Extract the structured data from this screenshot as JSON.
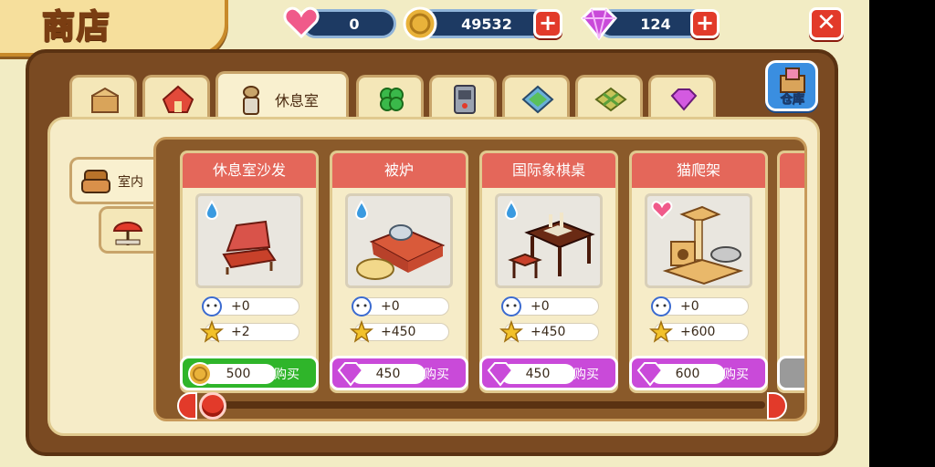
{
  "header": {
    "title": "商店"
  },
  "resources": {
    "hearts": "0",
    "coins": "49532",
    "gems": "124",
    "plus_symbol": "+",
    "close_symbol": "✕"
  },
  "top_tabs": [
    {
      "icon": "gift-box-icon"
    },
    {
      "icon": "house-roof-icon"
    },
    {
      "icon": "lounge-icon",
      "label": "休息室",
      "active": true
    },
    {
      "icon": "clover-icon"
    },
    {
      "icon": "appliance-icon"
    },
    {
      "icon": "wallpaper-icon"
    },
    {
      "icon": "floor-tile-icon"
    },
    {
      "icon": "gem-icon"
    }
  ],
  "storage_button": {
    "label": "仓库"
  },
  "side_tabs": [
    {
      "icon": "armchair-icon",
      "label": "室内",
      "active": true
    },
    {
      "icon": "beach-umbrella-icon"
    }
  ],
  "items": [
    {
      "name": "休息室沙发",
      "stat_a": "+0",
      "stat_b": "+2",
      "price": "500",
      "currency": "coin",
      "buy_label": "购买"
    },
    {
      "name": "被炉",
      "stat_a": "+0",
      "stat_b": "+450",
      "price": "450",
      "currency": "gem",
      "buy_label": "购买"
    },
    {
      "name": "国际象棋桌",
      "stat_a": "+0",
      "stat_b": "+450",
      "price": "450",
      "currency": "gem",
      "buy_label": "购买"
    },
    {
      "name": "猫爬架",
      "stat_a": "+0",
      "stat_b": "+600",
      "price": "600",
      "currency": "gem",
      "buy_label": "购买"
    }
  ],
  "colors": {
    "board": "#7a4a22",
    "card_header": "#e4675a",
    "coin_button": "#2fb52a",
    "gem_button": "#c94ad9",
    "accent_red": "#e23a2a"
  }
}
